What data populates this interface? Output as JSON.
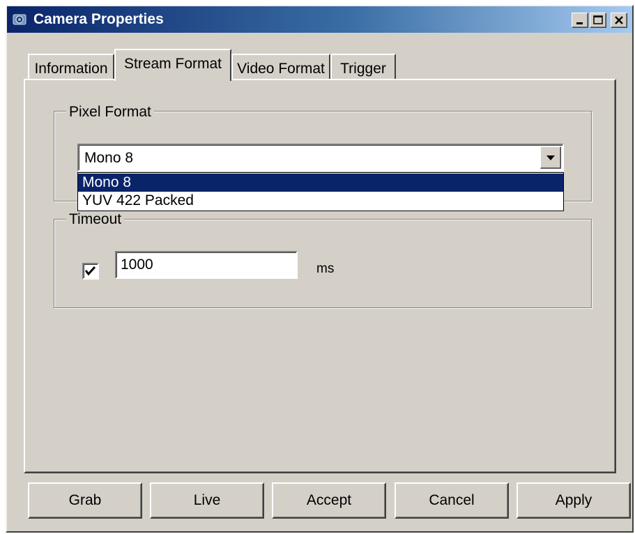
{
  "window": {
    "title": "Camera Properties",
    "title_icon": "camera-icon",
    "controls": {
      "minimize_icon": "minimize-icon",
      "maximize_icon": "maximize-icon",
      "close_icon": "close-icon"
    }
  },
  "tabs": [
    {
      "label": "Information",
      "selected": false
    },
    {
      "label": "Stream Format",
      "selected": true
    },
    {
      "label": "Video Format",
      "selected": false
    },
    {
      "label": "Trigger",
      "selected": false
    }
  ],
  "pixel_format": {
    "group_label": "Pixel Format",
    "selected_value": "Mono 8",
    "dropdown_open": true,
    "options": [
      "Mono 8",
      "YUV 422 Packed"
    ],
    "highlighted_index": 0
  },
  "timeout": {
    "group_label": "Timeout",
    "enabled": true,
    "value": "1000",
    "unit": "ms"
  },
  "buttons": {
    "grab": "Grab",
    "live": "Live",
    "accept": "Accept",
    "cancel": "Cancel",
    "apply": "Apply"
  },
  "colors": {
    "titlebar_start": "#0a246a",
    "titlebar_end": "#a6caf0",
    "dialog_bg": "#d4d0c8",
    "selection_bg": "#0a246a"
  }
}
